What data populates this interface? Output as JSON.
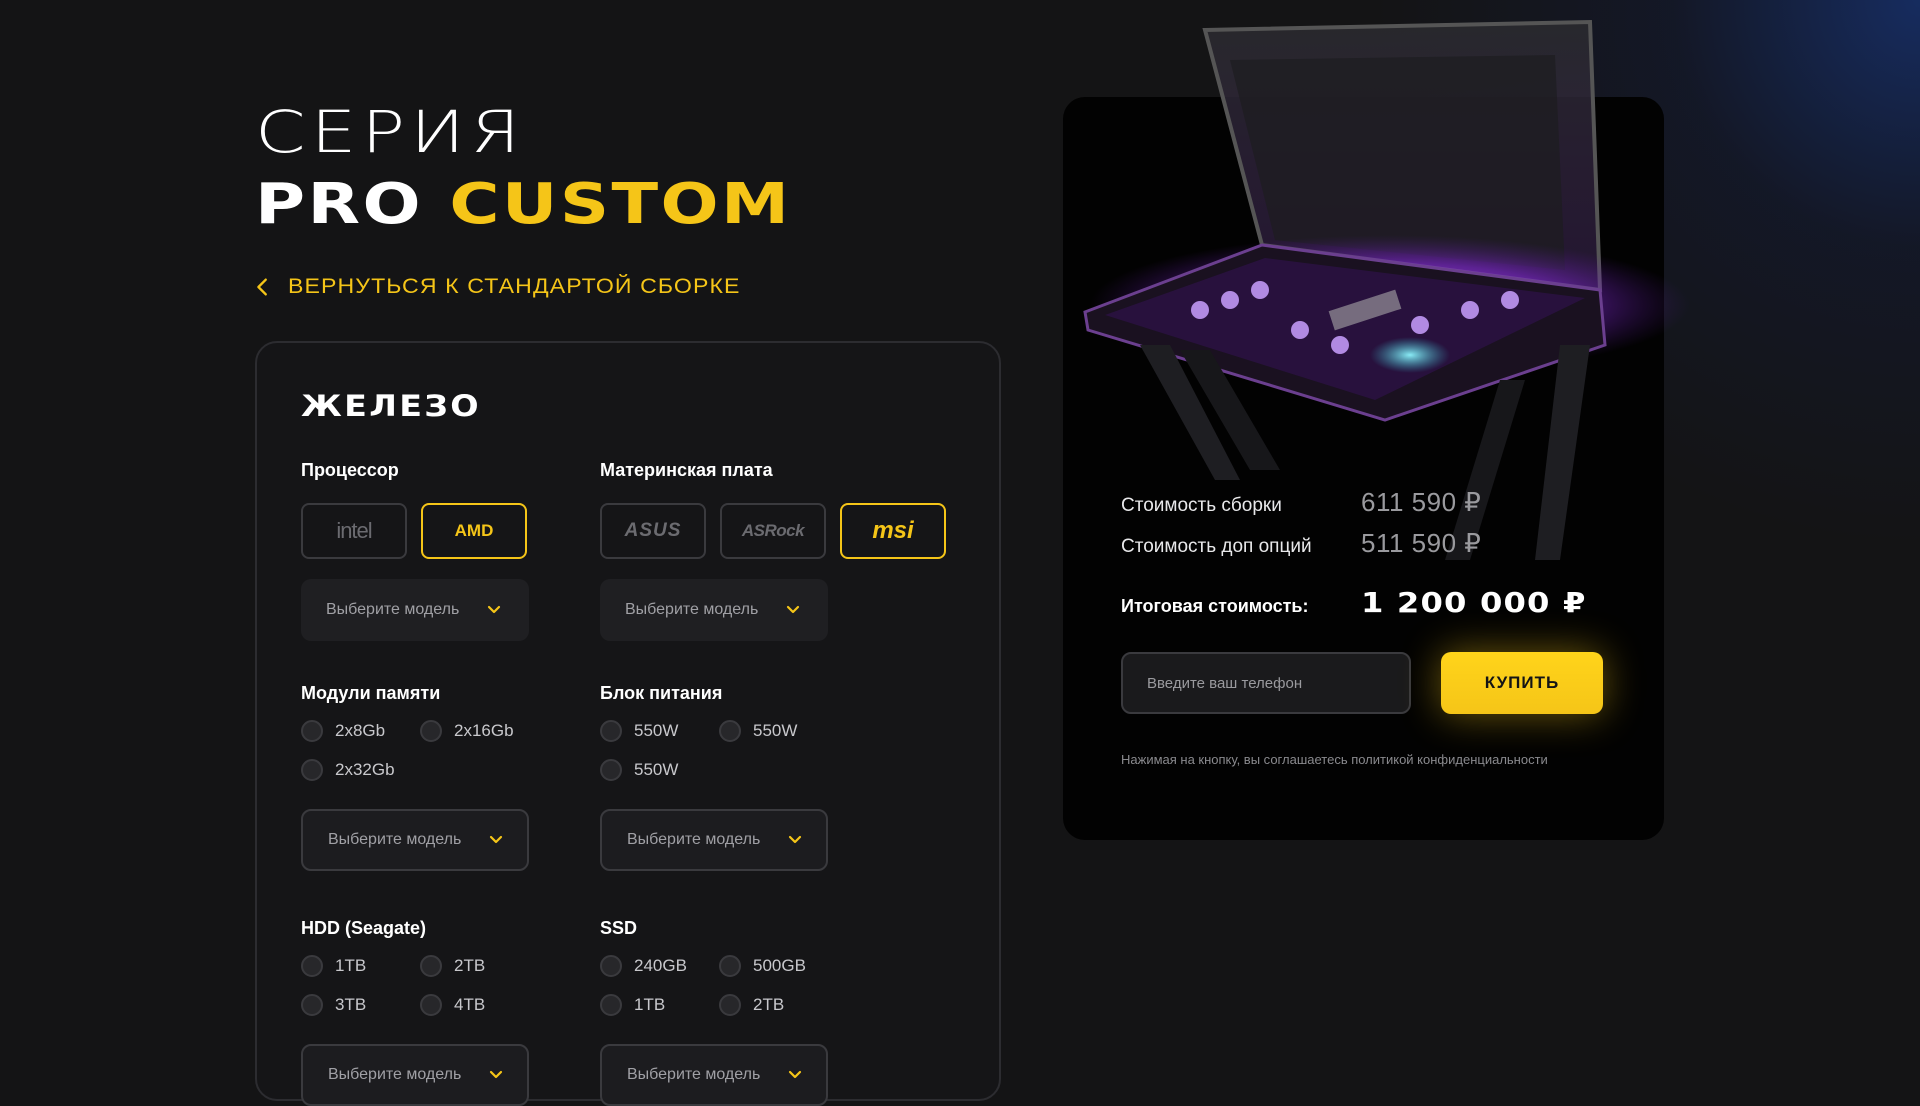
{
  "header": {
    "title_line1": "СЕРИЯ",
    "title_word1": "PRO",
    "title_word2": "CUSTOM",
    "back_link": "ВЕРНУТЬСЯ К СТАНДАРТОЙ СБОРКЕ"
  },
  "hardware": {
    "title": "ЖЕЛЕЗО",
    "processor": {
      "label": "Процессор",
      "brands": [
        "intel",
        "AMD"
      ],
      "selected_brand": "AMD",
      "select_placeholder": "Выберите модель"
    },
    "motherboard": {
      "label": "Материнская плата",
      "brands": [
        "ASUS",
        "ASRock",
        "msi"
      ],
      "selected_brand": "msi",
      "select_placeholder": "Выберите модель"
    },
    "memory": {
      "label": "Модули памяти",
      "options": [
        "2x8Gb",
        "2x16Gb",
        "2x32Gb"
      ],
      "select_placeholder": "Выберите модель"
    },
    "psu": {
      "label": "Блок питания",
      "options": [
        "550W",
        "550W",
        "550W"
      ],
      "select_placeholder": "Выберите модель"
    },
    "hdd": {
      "label": "HDD (Seagate)",
      "options": [
        "1TB",
        "2TB",
        "3TB",
        "4TB"
      ],
      "select_placeholder": "Выберите модель"
    },
    "ssd": {
      "label": "SSD",
      "options": [
        "240GB",
        "500GB",
        "1TB",
        "2TB"
      ],
      "select_placeholder": "Выберите модель"
    }
  },
  "summary": {
    "build_cost_label": "Стоимость сборки",
    "build_cost_value": "611 590 ₽",
    "options_cost_label": "Стоимость доп опций",
    "options_cost_value": "511 590 ₽",
    "total_label": "Итоговая стоимость:",
    "total_value": "1 200 000 ₽",
    "phone_placeholder": "Введите ваш телефон",
    "buy_label": "КУПИТЬ",
    "agreement": "Нажимая на кнопку, вы соглашаетесь политикой конфиденциальности"
  },
  "colors": {
    "accent": "#f5c518",
    "background": "#141415",
    "card": "#020202",
    "neon": "#b040ff"
  }
}
